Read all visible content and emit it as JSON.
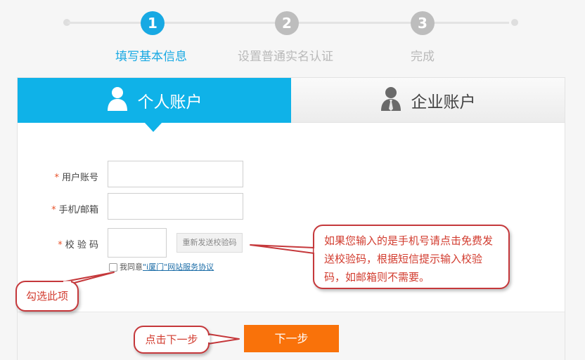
{
  "steps": [
    {
      "number": "1",
      "label": "填写基本信息",
      "active": true
    },
    {
      "number": "2",
      "label": "设置普通实名认证",
      "active": false
    },
    {
      "number": "3",
      "label": "完成",
      "active": false
    }
  ],
  "tabs": {
    "personal": {
      "label": "个人账户",
      "icon": "user-icon"
    },
    "company": {
      "label": "企业账户",
      "icon": "business-user-icon"
    }
  },
  "form": {
    "required_mark": "*",
    "username_label": "用户账号",
    "phone_email_label": "手机/邮箱",
    "code_label": "校 验 码",
    "resend_code_button": "重新发送校验码",
    "agree_prefix": "我同意",
    "agree_link": "\"i厦门\"网站服务协议"
  },
  "next_button": "下一步",
  "callouts": {
    "code_hint": "如果您输入的是手机号请点击免费发送校验码，根据短信提示输入校验码，如邮箱则不需要。",
    "check_hint": "勾选此项",
    "next_hint": "点击下一步"
  },
  "colors": {
    "accent": "#18a9e3",
    "tab_active": "#0fb2e8",
    "next_button": "#f9720a",
    "callout_border": "#c5383b",
    "required": "#e8532b"
  }
}
